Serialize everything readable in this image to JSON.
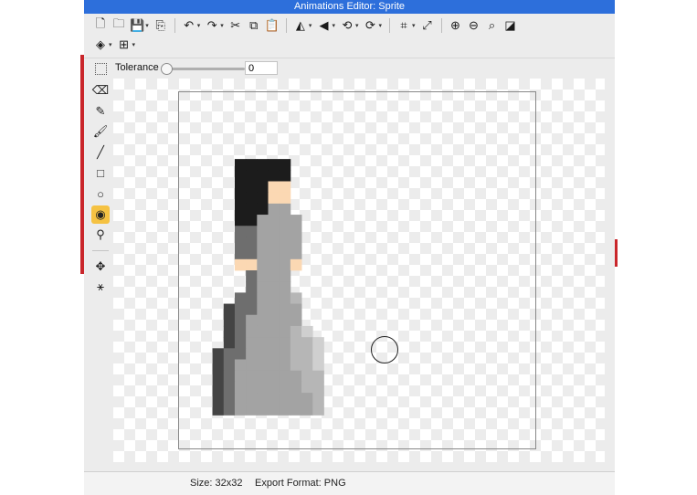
{
  "window": {
    "title": "Animations Editor: Sprite"
  },
  "toolbar": {
    "row1": [
      {
        "name": "new-file-icon",
        "glyph": "🗋",
        "caret": false
      },
      {
        "name": "open-folder-icon",
        "glyph": "🗀",
        "caret": false
      },
      {
        "name": "save-icon",
        "glyph": "💾",
        "caret": true
      },
      {
        "name": "export-icon",
        "glyph": "⎘",
        "caret": false
      },
      {
        "sep": true
      },
      {
        "name": "undo-icon",
        "glyph": "↶",
        "caret": true
      },
      {
        "name": "redo-icon",
        "glyph": "↷",
        "caret": true
      },
      {
        "name": "cut-icon",
        "glyph": "✂",
        "caret": false
      },
      {
        "name": "copy-icon",
        "glyph": "⧉",
        "caret": false
      },
      {
        "name": "paste-icon",
        "glyph": "📋",
        "caret": false
      },
      {
        "sep": true
      },
      {
        "name": "flip-horizontal-icon",
        "glyph": "◭",
        "caret": true
      },
      {
        "name": "flip-vertical-icon",
        "glyph": "◀",
        "caret": true
      },
      {
        "name": "rotate-left-icon",
        "glyph": "⟲",
        "caret": true
      },
      {
        "name": "rotate-right-icon",
        "glyph": "⟳",
        "caret": true
      },
      {
        "sep": true
      },
      {
        "name": "crop-icon",
        "glyph": "⌗",
        "caret": true
      },
      {
        "name": "resize-icon",
        "glyph": "⤢",
        "caret": false
      },
      {
        "sep": true
      },
      {
        "name": "zoom-in-icon",
        "glyph": "⊕",
        "caret": false
      },
      {
        "name": "zoom-out-icon",
        "glyph": "⊖",
        "caret": false
      },
      {
        "name": "zoom-fit-icon",
        "glyph": "⌕",
        "caret": false
      },
      {
        "name": "toggle-background-icon",
        "glyph": "◪",
        "caret": false
      }
    ],
    "row2": [
      {
        "name": "layers-icon",
        "glyph": "◈",
        "caret": true
      },
      {
        "name": "grid-icon",
        "glyph": "⊞",
        "caret": true
      }
    ]
  },
  "tolerance": {
    "label": "Tolerance",
    "value": "0",
    "level": 0
  },
  "tools": [
    {
      "name": "eraser-tool-icon",
      "glyph": "⌫",
      "active": false
    },
    {
      "name": "pencil-tool-icon",
      "glyph": "✎",
      "active": false
    },
    {
      "name": "brush-tool-icon",
      "glyph": "🖌",
      "active": false
    },
    {
      "name": "line-tool-icon",
      "glyph": "╱",
      "active": false
    },
    {
      "name": "rectangle-tool-icon",
      "glyph": "□",
      "active": false
    },
    {
      "name": "ellipse-tool-icon",
      "glyph": "○",
      "active": false
    },
    {
      "name": "fill-bucket-tool-icon",
      "glyph": "◉",
      "active": true
    },
    {
      "name": "eyedropper-tool-icon",
      "glyph": "⚲",
      "active": false
    },
    {
      "sep": true
    },
    {
      "name": "transform-tool-icon",
      "glyph": "✥",
      "active": false
    },
    {
      "name": "node-tool-icon",
      "glyph": "⚹",
      "active": false
    }
  ],
  "status": {
    "size": "Size: 32x32",
    "format": "Export Format: PNG"
  },
  "colors": {
    "hair": "#1c1c1c",
    "skin": "#fbd8b3",
    "dress_dark": "#444444",
    "dress_mid_dark": "#6e6e6e",
    "dress_main": "#a3a3a3",
    "dress_light": "#b6b6b6",
    "dress_lighter": "#cfcfcf",
    "active_tool": "#f5c242"
  },
  "sprite": {
    "grid": 32,
    "cells": [
      [
        5,
        6,
        "hair"
      ],
      [
        6,
        6,
        "hair"
      ],
      [
        7,
        6,
        "hair"
      ],
      [
        8,
        6,
        "hair"
      ],
      [
        9,
        6,
        "hair"
      ],
      [
        5,
        7,
        "hair"
      ],
      [
        6,
        7,
        "hair"
      ],
      [
        7,
        7,
        "hair"
      ],
      [
        8,
        7,
        "hair"
      ],
      [
        9,
        7,
        "hair"
      ],
      [
        5,
        8,
        "hair"
      ],
      [
        6,
        8,
        "hair"
      ],
      [
        7,
        8,
        "hair"
      ],
      [
        8,
        8,
        "skin"
      ],
      [
        9,
        8,
        "skin"
      ],
      [
        5,
        9,
        "hair"
      ],
      [
        6,
        9,
        "hair"
      ],
      [
        7,
        9,
        "hair"
      ],
      [
        8,
        9,
        "skin"
      ],
      [
        9,
        9,
        "skin"
      ],
      [
        5,
        10,
        "hair"
      ],
      [
        6,
        10,
        "hair"
      ],
      [
        7,
        10,
        "hair"
      ],
      [
        8,
        10,
        "dress_main"
      ],
      [
        9,
        10,
        "dress_main"
      ],
      [
        5,
        11,
        "hair"
      ],
      [
        6,
        11,
        "hair"
      ],
      [
        7,
        11,
        "dress_main"
      ],
      [
        8,
        11,
        "dress_main"
      ],
      [
        9,
        11,
        "dress_main"
      ],
      [
        10,
        11,
        "dress_main"
      ],
      [
        5,
        12,
        "dress_mid_dark"
      ],
      [
        6,
        12,
        "dress_mid_dark"
      ],
      [
        7,
        12,
        "dress_main"
      ],
      [
        8,
        12,
        "dress_main"
      ],
      [
        9,
        12,
        "dress_main"
      ],
      [
        10,
        12,
        "dress_main"
      ],
      [
        5,
        13,
        "dress_mid_dark"
      ],
      [
        6,
        13,
        "dress_mid_dark"
      ],
      [
        7,
        13,
        "dress_main"
      ],
      [
        8,
        13,
        "dress_main"
      ],
      [
        9,
        13,
        "dress_main"
      ],
      [
        10,
        13,
        "dress_main"
      ],
      [
        5,
        14,
        "dress_mid_dark"
      ],
      [
        6,
        14,
        "dress_mid_dark"
      ],
      [
        7,
        14,
        "dress_main"
      ],
      [
        8,
        14,
        "dress_main"
      ],
      [
        9,
        14,
        "dress_main"
      ],
      [
        10,
        14,
        "dress_main"
      ],
      [
        5,
        15,
        "skin"
      ],
      [
        6,
        15,
        "skin"
      ],
      [
        7,
        15,
        "dress_main"
      ],
      [
        8,
        15,
        "dress_main"
      ],
      [
        9,
        15,
        "dress_main"
      ],
      [
        10,
        15,
        "skin"
      ],
      [
        6,
        16,
        "dress_mid_dark"
      ],
      [
        7,
        16,
        "dress_main"
      ],
      [
        8,
        16,
        "dress_main"
      ],
      [
        9,
        16,
        "dress_main"
      ],
      [
        6,
        17,
        "dress_mid_dark"
      ],
      [
        7,
        17,
        "dress_main"
      ],
      [
        8,
        17,
        "dress_main"
      ],
      [
        9,
        17,
        "dress_main"
      ],
      [
        5,
        18,
        "dress_mid_dark"
      ],
      [
        6,
        18,
        "dress_mid_dark"
      ],
      [
        7,
        18,
        "dress_main"
      ],
      [
        8,
        18,
        "dress_main"
      ],
      [
        9,
        18,
        "dress_main"
      ],
      [
        10,
        18,
        "dress_light"
      ],
      [
        4,
        19,
        "dress_dark"
      ],
      [
        5,
        19,
        "dress_mid_dark"
      ],
      [
        6,
        19,
        "dress_mid_dark"
      ],
      [
        7,
        19,
        "dress_main"
      ],
      [
        8,
        19,
        "dress_main"
      ],
      [
        9,
        19,
        "dress_main"
      ],
      [
        10,
        19,
        "dress_main"
      ],
      [
        4,
        20,
        "dress_dark"
      ],
      [
        5,
        20,
        "dress_mid_dark"
      ],
      [
        6,
        20,
        "dress_main"
      ],
      [
        7,
        20,
        "dress_main"
      ],
      [
        8,
        20,
        "dress_main"
      ],
      [
        9,
        20,
        "dress_main"
      ],
      [
        10,
        20,
        "dress_main"
      ],
      [
        4,
        21,
        "dress_dark"
      ],
      [
        5,
        21,
        "dress_mid_dark"
      ],
      [
        6,
        21,
        "dress_main"
      ],
      [
        7,
        21,
        "dress_main"
      ],
      [
        8,
        21,
        "dress_main"
      ],
      [
        9,
        21,
        "dress_main"
      ],
      [
        10,
        21,
        "dress_light"
      ],
      [
        11,
        21,
        "dress_lighter"
      ],
      [
        4,
        22,
        "dress_dark"
      ],
      [
        5,
        22,
        "dress_mid_dark"
      ],
      [
        6,
        22,
        "dress_main"
      ],
      [
        7,
        22,
        "dress_main"
      ],
      [
        8,
        22,
        "dress_main"
      ],
      [
        9,
        22,
        "dress_main"
      ],
      [
        10,
        22,
        "dress_light"
      ],
      [
        11,
        22,
        "dress_light"
      ],
      [
        12,
        22,
        "dress_lighter"
      ],
      [
        3,
        23,
        "dress_dark"
      ],
      [
        4,
        23,
        "dress_mid_dark"
      ],
      [
        5,
        23,
        "dress_mid_dark"
      ],
      [
        6,
        23,
        "dress_main"
      ],
      [
        7,
        23,
        "dress_main"
      ],
      [
        8,
        23,
        "dress_main"
      ],
      [
        9,
        23,
        "dress_main"
      ],
      [
        10,
        23,
        "dress_light"
      ],
      [
        11,
        23,
        "dress_light"
      ],
      [
        12,
        23,
        "dress_lighter"
      ],
      [
        3,
        24,
        "dress_dark"
      ],
      [
        4,
        24,
        "dress_mid_dark"
      ],
      [
        5,
        24,
        "dress_main"
      ],
      [
        6,
        24,
        "dress_main"
      ],
      [
        7,
        24,
        "dress_main"
      ],
      [
        8,
        24,
        "dress_main"
      ],
      [
        9,
        24,
        "dress_main"
      ],
      [
        10,
        24,
        "dress_light"
      ],
      [
        11,
        24,
        "dress_light"
      ],
      [
        12,
        24,
        "dress_lighter"
      ],
      [
        3,
        25,
        "dress_dark"
      ],
      [
        4,
        25,
        "dress_mid_dark"
      ],
      [
        5,
        25,
        "dress_main"
      ],
      [
        6,
        25,
        "dress_main"
      ],
      [
        7,
        25,
        "dress_main"
      ],
      [
        8,
        25,
        "dress_main"
      ],
      [
        9,
        25,
        "dress_main"
      ],
      [
        10,
        25,
        "dress_main"
      ],
      [
        11,
        25,
        "dress_light"
      ],
      [
        12,
        25,
        "dress_light"
      ],
      [
        3,
        26,
        "dress_dark"
      ],
      [
        4,
        26,
        "dress_mid_dark"
      ],
      [
        5,
        26,
        "dress_main"
      ],
      [
        6,
        26,
        "dress_main"
      ],
      [
        7,
        26,
        "dress_main"
      ],
      [
        8,
        26,
        "dress_main"
      ],
      [
        9,
        26,
        "dress_main"
      ],
      [
        10,
        26,
        "dress_main"
      ],
      [
        11,
        26,
        "dress_light"
      ],
      [
        12,
        26,
        "dress_light"
      ],
      [
        3,
        27,
        "dress_dark"
      ],
      [
        4,
        27,
        "dress_mid_dark"
      ],
      [
        5,
        27,
        "dress_main"
      ],
      [
        6,
        27,
        "dress_main"
      ],
      [
        7,
        27,
        "dress_main"
      ],
      [
        8,
        27,
        "dress_main"
      ],
      [
        9,
        27,
        "dress_main"
      ],
      [
        10,
        27,
        "dress_main"
      ],
      [
        11,
        27,
        "dress_main"
      ],
      [
        12,
        27,
        "dress_light"
      ],
      [
        3,
        28,
        "dress_dark"
      ],
      [
        4,
        28,
        "dress_mid_dark"
      ],
      [
        5,
        28,
        "dress_main"
      ],
      [
        6,
        28,
        "dress_main"
      ],
      [
        7,
        28,
        "dress_main"
      ],
      [
        8,
        28,
        "dress_main"
      ],
      [
        9,
        28,
        "dress_main"
      ],
      [
        10,
        28,
        "dress_main"
      ],
      [
        11,
        28,
        "dress_main"
      ],
      [
        12,
        28,
        "dress_light"
      ]
    ]
  }
}
